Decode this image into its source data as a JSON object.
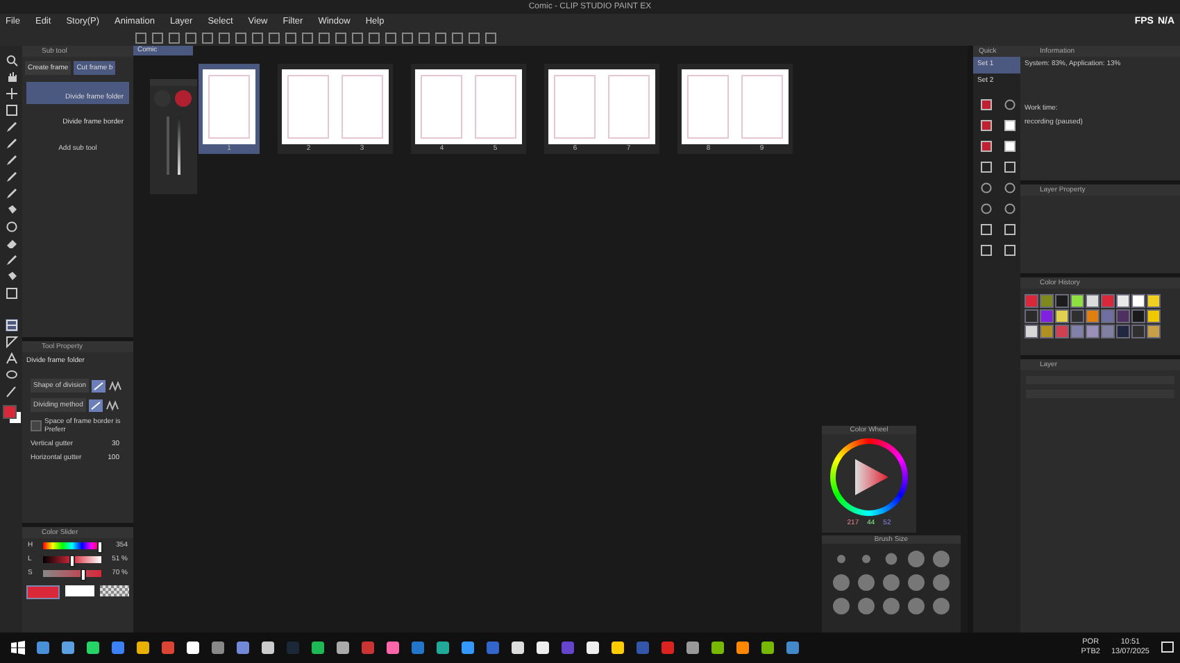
{
  "window": {
    "title": "Comic - CLIP STUDIO PAINT EX"
  },
  "menu": [
    "File",
    "Edit",
    "Story(P)",
    "Animation",
    "Layer",
    "Select",
    "View",
    "Filter",
    "Window",
    "Help"
  ],
  "fps": {
    "label": "FPS",
    "value": "N/A"
  },
  "sub_tool": {
    "title": "Sub tool",
    "tabs": [
      {
        "label": "Create frame",
        "selected": false
      },
      {
        "label": "Cut frame b",
        "selected": true
      }
    ],
    "items": [
      {
        "label": "Divide frame folder",
        "selected": true
      },
      {
        "label": "Divide frame border",
        "selected": false
      }
    ],
    "add": "Add sub tool"
  },
  "tool_property": {
    "title": "Tool Property",
    "tool": "Divide frame folder",
    "rows": [
      {
        "kind": "icons",
        "label": "Shape of division"
      },
      {
        "kind": "icons",
        "label": "Dividing method"
      },
      {
        "kind": "checkbox",
        "label": "Space of frame border is Preferr",
        "checked": false
      },
      {
        "kind": "number",
        "label": "Vertical gutter",
        "value": "30"
      },
      {
        "kind": "number",
        "label": "Horizontal gutter",
        "value": "100"
      }
    ]
  },
  "color_slider": {
    "title": "Color Slider",
    "sliders": [
      {
        "label": "H",
        "value": "354",
        "level": 0.98,
        "kind": "hue"
      },
      {
        "label": "L",
        "value": "51 %",
        "level": 0.51,
        "kind": "lightness"
      },
      {
        "label": "S",
        "value": "70 %",
        "level": 0.7,
        "kind": "saturation"
      }
    ]
  },
  "canvas": {
    "tab": "Comic",
    "pages": [
      {
        "numbers": [
          "1"
        ],
        "selected": true
      },
      {
        "numbers": [
          "2",
          "3"
        ],
        "selected": false
      },
      {
        "numbers": [
          "4",
          "5"
        ],
        "selected": false
      },
      {
        "numbers": [
          "6",
          "7"
        ],
        "selected": false
      },
      {
        "numbers": [
          "8",
          "9"
        ],
        "selected": false
      }
    ]
  },
  "quick_access": {
    "title": "Quick",
    "sets": [
      {
        "label": "Set 1",
        "selected": true
      },
      {
        "label": "Set 2",
        "selected": false
      }
    ]
  },
  "information": {
    "title": "Information",
    "usage": "System: 83%, Application: 13%",
    "work_time": "Work time:",
    "recording": "recording (paused)"
  },
  "layer_property": {
    "title": "Layer Property"
  },
  "color_history": {
    "title": "Color History",
    "colors": [
      {
        "color": "#d8283a"
      },
      {
        "color": "#7f8a1e"
      },
      {
        "color": "#1c1c1c"
      },
      {
        "color": "#8ee040"
      },
      {
        "color": "#dcdcdc"
      },
      {
        "color": "#d8283a"
      },
      {
        "color": "#e8e8e8"
      },
      {
        "color": "#ffffff"
      },
      {
        "color": "#f0d020"
      },
      {
        "color": "#2a2a2a"
      },
      {
        "color": "#8020e0"
      },
      {
        "color": "#e0d050"
      },
      {
        "color": "#303030"
      },
      {
        "color": "#e08010"
      },
      {
        "color": "#7070a0"
      },
      {
        "color": "#503060"
      },
      {
        "color": "#1a1a1a"
      },
      {
        "color": "#f0c800"
      },
      {
        "color": "#d8d8d8"
      },
      {
        "color": "#b09020"
      },
      {
        "color": "#d04050"
      },
      {
        "color": "#8080a8"
      },
      {
        "color": "#9a90b8"
      },
      {
        "color": "#8080a0"
      },
      {
        "color": "#202840"
      },
      {
        "color": "#303030"
      },
      {
        "color": "#c8a048"
      }
    ]
  },
  "layer": {
    "title": "Layer"
  },
  "color_wheel": {
    "title": "Color Wheel",
    "r": "217",
    "g": "44",
    "b": "52"
  },
  "brush_size": {
    "title": "Brush Size"
  },
  "taskbar": {
    "language": "POR",
    "layout": "PTB2",
    "time": "10:51",
    "date": "13/07/2025"
  }
}
